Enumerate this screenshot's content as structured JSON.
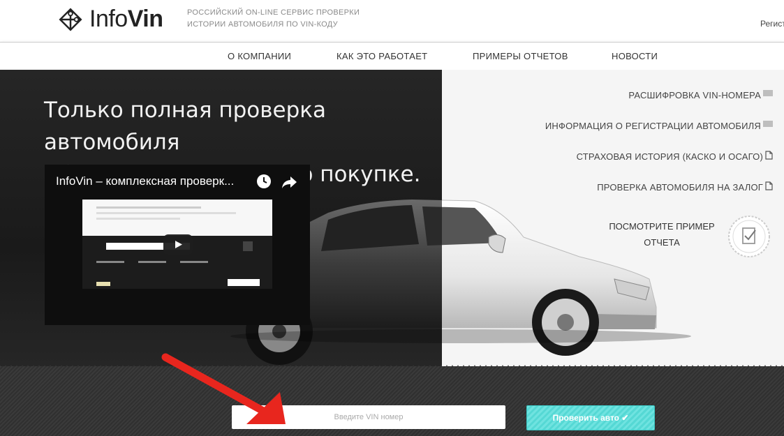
{
  "header": {
    "logo_text_light": "Info",
    "logo_text_bold": "Vin",
    "tagline_line1": "Российский on-line сервис проверки",
    "tagline_line2": "истории автомобиля по VIN-коду",
    "register_link": "Регистрация"
  },
  "nav": {
    "items": [
      {
        "label": "О КОМПАНИИ"
      },
      {
        "label": "КАК ЭТО РАБОТАЕТ"
      },
      {
        "label": "ПРИМЕРЫ ОТЧЕТОВ"
      },
      {
        "label": "НОВОСТИ"
      }
    ]
  },
  "hero": {
    "title_line1": "Только полная проверка автомобиля",
    "title_line2": "обезопасит вас при его покупке.",
    "video_title": "InfoVin – комплексная проверк...",
    "features": [
      {
        "label": "РАСШИФРОВКА VIN-НОМЕРА",
        "icon": "barcode-icon"
      },
      {
        "label": "ИНФОРМАЦИЯ О РЕГИСТРАЦИИ АВТОМОБИЛЯ",
        "icon": "barcode-icon"
      },
      {
        "label": "СТРАХОВАЯ ИСТОРИЯ (КАСКО И ОСАГО)",
        "icon": "document-icon"
      },
      {
        "label": "ПРОВЕРКА АВТОМОБИЛЯ НА ЗАЛОГ",
        "icon": "document-icon"
      }
    ],
    "sample_line1": "ПОСМОТРИТЕ ПРИМЕР",
    "sample_line2": "ОТЧЕТА"
  },
  "search": {
    "vin_placeholder": "Введите VIN номер",
    "check_button": "Проверить авто ✔"
  },
  "colors": {
    "accent": "#5ad9d5",
    "dark_bg": "#1f1f1f",
    "arrow": "#e8261e"
  }
}
